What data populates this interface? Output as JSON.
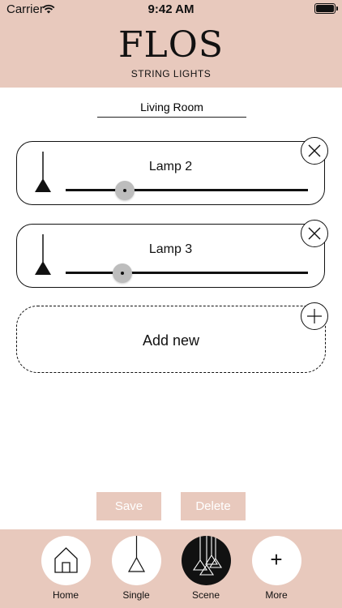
{
  "status_bar": {
    "carrier": "Carrier",
    "time": "9:42 AM"
  },
  "header": {
    "logo": "FLOS",
    "subtitle": "STRING LIGHTS"
  },
  "scene": {
    "room_name": "Living Room",
    "lamps": [
      {
        "name": "Lamp 2",
        "brightness": 0.24
      },
      {
        "name": "Lamp 3",
        "brightness": 0.23
      }
    ],
    "add_label": "Add new"
  },
  "actions": {
    "save": "Save",
    "delete": "Delete"
  },
  "tabbar": {
    "items": [
      {
        "label": "Home",
        "icon": "house-icon"
      },
      {
        "label": "Single",
        "icon": "pendant-lamp-icon"
      },
      {
        "label": "Scene",
        "icon": "lamp-cluster-icon",
        "active": true
      },
      {
        "label": "More",
        "icon": "plus-icon"
      }
    ]
  },
  "colors": {
    "accent": "#e8c9bd",
    "active_tab": "#111111",
    "thumb": "#bdbdbd"
  }
}
